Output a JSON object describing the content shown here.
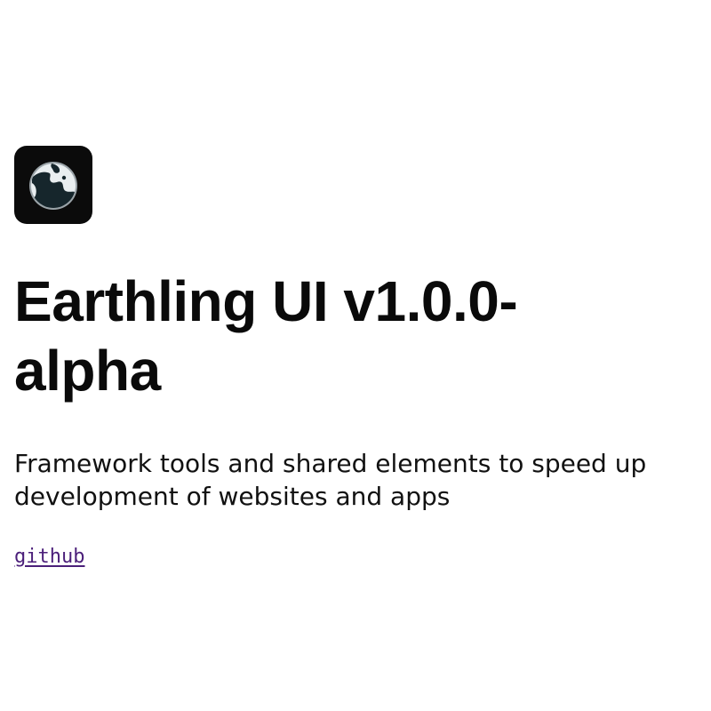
{
  "logo": {
    "icon": "earth-icon",
    "background": "#0b0b0b"
  },
  "header": {
    "title": "Earthling UI v1.0.0-alpha"
  },
  "main": {
    "description": "Framework tools and shared elements to speed up development of websites and apps"
  },
  "links": {
    "github_label": "github",
    "link_color": "#4b1f7a"
  }
}
